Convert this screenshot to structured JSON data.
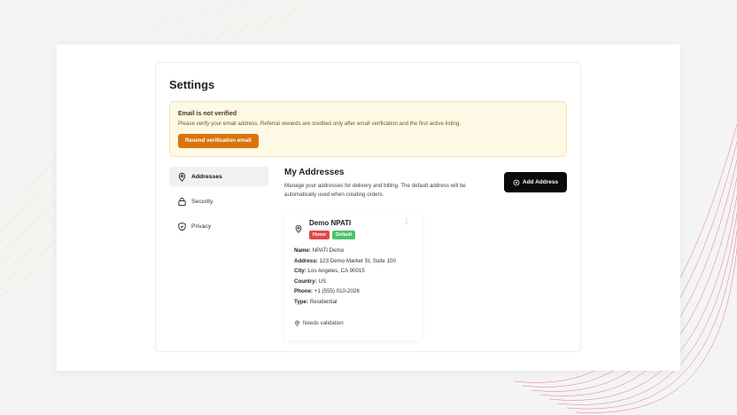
{
  "page": {
    "title": "Settings"
  },
  "alert": {
    "title": "Email is not verified",
    "message": "Please verify your email address. Referral rewards are credited only after email verification and the first active listing.",
    "button_label": "Resend verification email",
    "bg_color": "#fdf9e4",
    "button_color": "#d9740b"
  },
  "sidebar": {
    "items": [
      {
        "label": "Addresses",
        "icon": "map-pin-icon",
        "active": true
      },
      {
        "label": "Security",
        "icon": "lock-icon",
        "active": false
      },
      {
        "label": "Privacy",
        "icon": "shield-icon",
        "active": false
      }
    ]
  },
  "addresses": {
    "title": "My Addresses",
    "description": "Manage your addresses for delivery and billing. The default address will be automatically used when creating orders.",
    "add_button_label": "Add Address",
    "card": {
      "name": "Demo NPATI",
      "badges": [
        {
          "label": "Home",
          "color": "#e04848"
        },
        {
          "label": "Default",
          "color": "#4cc46a"
        }
      ],
      "fields": [
        {
          "label": "Name:",
          "value": "NPATI Demo"
        },
        {
          "label": "Address:",
          "value": "123 Demo Market St, Suite 100"
        },
        {
          "label": "City:",
          "value": "Los Angeles, CA 90015"
        },
        {
          "label": "Country:",
          "value": "US"
        },
        {
          "label": "Phone:",
          "value": "+1 (555) 010-2026"
        },
        {
          "label": "Type:",
          "value": "Residential"
        }
      ],
      "validation": "Needs validation"
    }
  }
}
